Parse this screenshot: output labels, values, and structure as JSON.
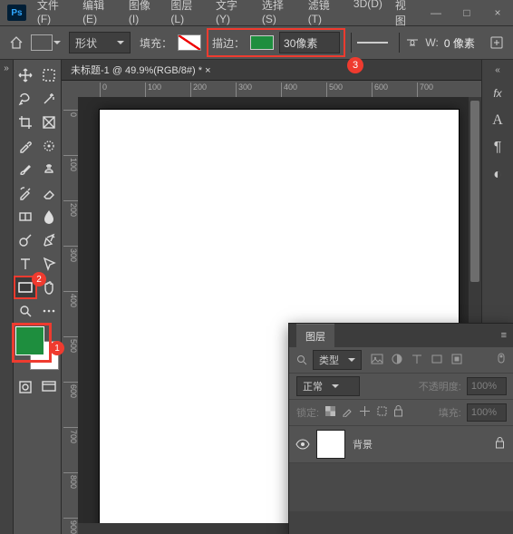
{
  "app": {
    "logo": "Ps"
  },
  "menus": [
    "文件(F)",
    "编辑(E)",
    "图像(I)",
    "图层(L)",
    "文字(Y)",
    "选择(S)",
    "滤镜(T)",
    "3D(D)",
    "视图"
  ],
  "winbtns": {
    "min": "—",
    "max": "□",
    "close": "×"
  },
  "options": {
    "mode_label": "形状",
    "fill_label": "填充：",
    "stroke_label": "描边：",
    "stroke_value": "30像素",
    "stroke_color": "#1e8e3e",
    "w_label": "W:",
    "w0": "0 像素"
  },
  "doc": {
    "tab_title": "未标题-1 @ 49.9%(RGB/8#) * ×"
  },
  "ruler_h": [
    "0",
    "100",
    "200",
    "300",
    "400",
    "500",
    "600",
    "700"
  ],
  "ruler_v": [
    "0",
    "100",
    "200",
    "300",
    "400",
    "500",
    "600",
    "700",
    "800",
    "900"
  ],
  "annotations": {
    "b1": "1",
    "b2": "2",
    "b3": "3"
  },
  "tool_rect_name": "rectangle-tool",
  "right_icons": [
    "fx",
    "A",
    "¶",
    "◐"
  ],
  "layers_panel": {
    "tab": "图层",
    "filter_kind": "类型",
    "blend_mode": "正常",
    "opacity_label": "不透明度:",
    "opacity_value": "100%",
    "lock_label": "锁定:",
    "fill_label": "填充:",
    "fill_value": "100%",
    "layer_items": [
      {
        "name": "背景",
        "locked": true,
        "visible": true
      }
    ]
  },
  "colors": {
    "foreground": "#1e8e3e",
    "background": "#ffffff"
  }
}
